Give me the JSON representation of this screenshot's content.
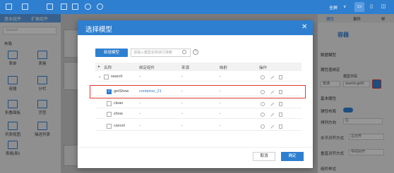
{
  "topbar": {
    "fullscreen_label": "全屏",
    "dropdown_label": "∨"
  },
  "left_panel": {
    "tabs": [
      "基本组件",
      "扩展组件"
    ],
    "search_placeholder": "Search",
    "section_label": "布局",
    "items": [
      {
        "label": "表单",
        "icon": "form-icon"
      },
      {
        "label": "表格",
        "icon": "table-icon"
      },
      {
        "label": "容器",
        "icon": "container-icon"
      },
      {
        "label": "分栏",
        "icon": "columns-icon"
      },
      {
        "label": "折叠面板",
        "icon": "collapse-icon"
      },
      {
        "label": "页签",
        "icon": "tabs-icon"
      },
      {
        "label": "列表视图",
        "icon": "list-view-icon"
      },
      {
        "label": "描述列表",
        "icon": "description-list-icon"
      },
      {
        "label": "表格(新)",
        "icon": "new-table-icon"
      }
    ]
  },
  "right_panel": {
    "tabs": [
      "属性",
      "事件",
      "样"
    ],
    "container_title": "容器",
    "data_model_label": "数据模型",
    "bind_model_label": "属性值绑定",
    "model_field_label": "模型字段",
    "field_value": "search.getS",
    "select_value": "普通",
    "basic_props_label": "基本属性",
    "flex_label": "弹性布局",
    "direction_label": "排列方向",
    "direction_value": "行",
    "h_align_label": "水平对齐方式",
    "h_align_value": "左对齐",
    "v_align_label": "垂直对齐方式",
    "v_align_value": "中间对齐",
    "footer_label": "组件样式"
  },
  "modal": {
    "title": "选择模型",
    "new_button": "新增模型",
    "search_placeholder": "请输入模型名称进行搜索",
    "columns": [
      "名称",
      "绑定组件",
      "来源",
      "映射",
      "操作"
    ],
    "rows": [
      {
        "name": "search",
        "bound": "-",
        "source": "-",
        "mapping": "-",
        "checked": false,
        "parent": true
      },
      {
        "name": "getShow",
        "bound": "container_21",
        "source": "-",
        "mapping": "-",
        "checked": true,
        "parent": false
      },
      {
        "name": "clean",
        "bound": "-",
        "source": "-",
        "mapping": "-",
        "checked": false,
        "parent": false
      },
      {
        "name": "show",
        "bound": "-",
        "source": "-",
        "mapping": "-",
        "checked": false,
        "parent": false
      },
      {
        "name": "cancel",
        "bound": "-",
        "source": "-",
        "mapping": "-",
        "checked": false,
        "parent": false
      }
    ],
    "cancel_button": "取消",
    "ok_button": "确定"
  },
  "colors": {
    "accent": "#2e7fd0",
    "highlight": "#e03a2f"
  }
}
